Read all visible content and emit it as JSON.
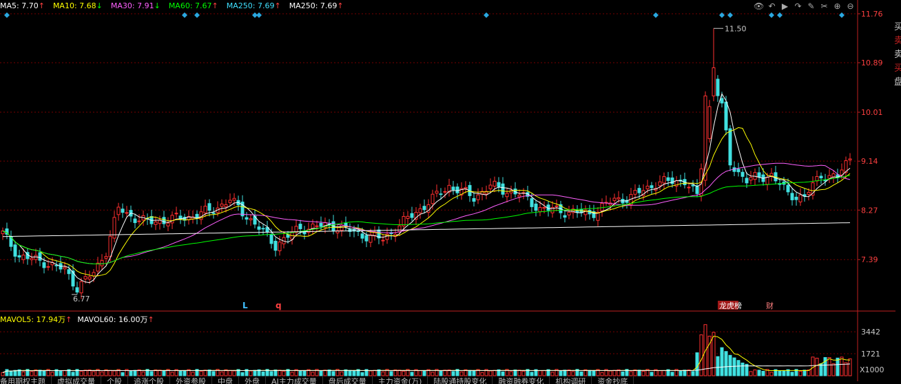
{
  "ma_legend": [
    {
      "label": "MA5: 7.70",
      "arrow": "↑",
      "color": "#ffffff",
      "arrow_color": "#ff4040"
    },
    {
      "label": "MA10: 7.68",
      "arrow": "↓",
      "color": "#ffff00",
      "arrow_color": "#00ff00"
    },
    {
      "label": "MA30: 7.91",
      "arrow": "↓",
      "color": "#ff60ff",
      "arrow_color": "#00ff00"
    },
    {
      "label": "MA60: 7.67",
      "arrow": "↑",
      "color": "#00ff00",
      "arrow_color": "#ff4040"
    },
    {
      "label": "MA250: 7.69",
      "arrow": "↑",
      "color": "#40e0ff",
      "arrow_color": "#ff4040"
    },
    {
      "label": "MA250: 7.69",
      "arrow": "↑",
      "color": "#ffffff",
      "arrow_color": "#ff4040"
    }
  ],
  "vol_legend": [
    {
      "label": "MAVOL5: 17.94万",
      "arrow": "↑",
      "color": "#ffff00",
      "arrow_color": "#ff4040"
    },
    {
      "label": "MAVOL60: 16.00万",
      "arrow": "↑",
      "color": "#ffffff",
      "arrow_color": "#ff4040"
    }
  ],
  "toolbar_icons": [
    "eye-icon",
    "undo-icon",
    "play-icon",
    "redo-icon",
    "settings-icon",
    "cross-icon",
    "zoom-in-icon",
    "zoom-out-icon"
  ],
  "toolbar_glyphs": [
    "👁",
    "↶",
    "▶",
    "↷",
    "✎",
    "✂",
    "⊕",
    "⊖"
  ],
  "markers": {
    "L": "L",
    "q": "q",
    "longhu": "龙虎榜",
    "cai": "财"
  },
  "colors": {
    "up": "#ff3030",
    "down": "#40e0e0",
    "grid": "#7a0000",
    "axis": "#c02020",
    "price_label": "#ff4040"
  },
  "tabs": [
    "备用期权主题",
    "虚拟成交量",
    "个股",
    "追涨个股",
    "外资参股",
    "中盘",
    "外盘",
    "AI主力成交量",
    "盘后成交量",
    "主力资金(万)",
    "陆股通持股变化",
    "融资融券变化",
    "机构调研",
    "资金抄底"
  ],
  "side_chars": [
    "买",
    "卖",
    "卖",
    "买",
    "盘"
  ],
  "chart_data": [
    {
      "type": "candlestick",
      "y_ticks": [
        "11.76",
        "10.89",
        "10.01",
        "9.14",
        "8.27",
        "7.39"
      ],
      "ylim": [
        6.5,
        11.76
      ],
      "annotations": {
        "high": "11.50",
        "low": "6.77"
      },
      "grid": true
    },
    {
      "type": "bar",
      "y_ticks": [
        "3442",
        "1721"
      ],
      "unit": "X1000",
      "ylim": [
        0,
        4200
      ]
    }
  ]
}
